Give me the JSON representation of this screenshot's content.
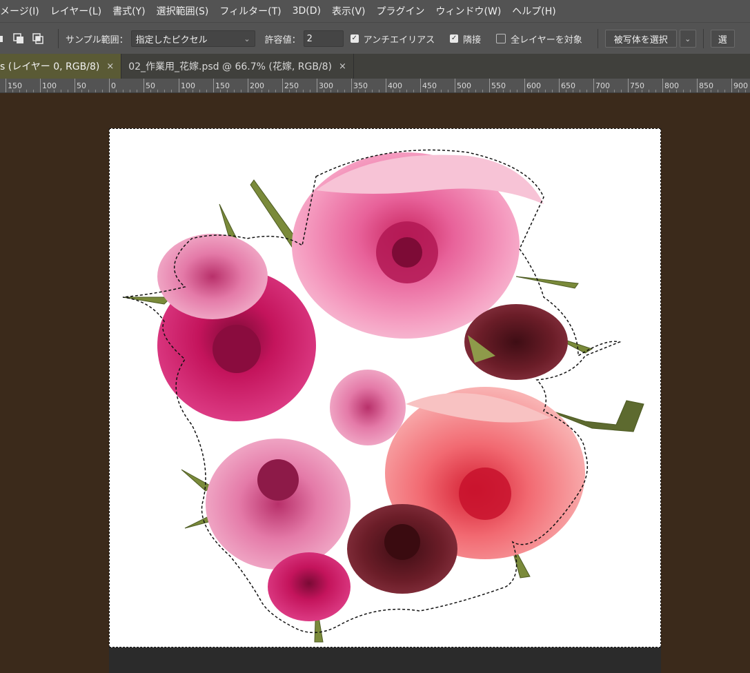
{
  "menu": [
    "メージ(I)",
    "レイヤー(L)",
    "書式(Y)",
    "選択範囲(S)",
    "フィルター(T)",
    "3D(D)",
    "表示(V)",
    "プラグイン",
    "ウィンドウ(W)",
    "ヘルプ(H)"
  ],
  "options": {
    "sample_label": "サンプル範囲：",
    "sample_value": "指定したピクセル",
    "tolerance_label": "許容値：",
    "tolerance_value": "2",
    "antialias_label": "アンチエイリアス",
    "antialias_checked": true,
    "contiguous_label": "隣接",
    "contiguous_checked": true,
    "all_layers_label": "全レイヤーを対象",
    "all_layers_checked": false,
    "subject_button": "被写体を選択",
    "select_mask_button": "選"
  },
  "tabs": [
    {
      "label": "s (レイヤー 0, RGB/8)",
      "close": "×",
      "active": true
    },
    {
      "label": "02_作業用_花嫁.psd @ 66.7% (花嫁, RGB/8)",
      "close": "×",
      "active": false
    }
  ],
  "ruler": [
    "150",
    "100",
    "50",
    "0",
    "50",
    "100",
    "150",
    "200",
    "250",
    "300",
    "350",
    "400",
    "450",
    "500",
    "550",
    "600",
    "650",
    "700",
    "750",
    "800",
    "850",
    "900"
  ],
  "colors": {
    "accent": "#5a5a35",
    "workarea": "#3b2a1b",
    "chrome": "#535353"
  },
  "icons": [
    "selection-mode-icon",
    "selection-subtract-icon",
    "selection-intersect-icon",
    "dropdown-chevron-icon",
    "close-icon"
  ]
}
